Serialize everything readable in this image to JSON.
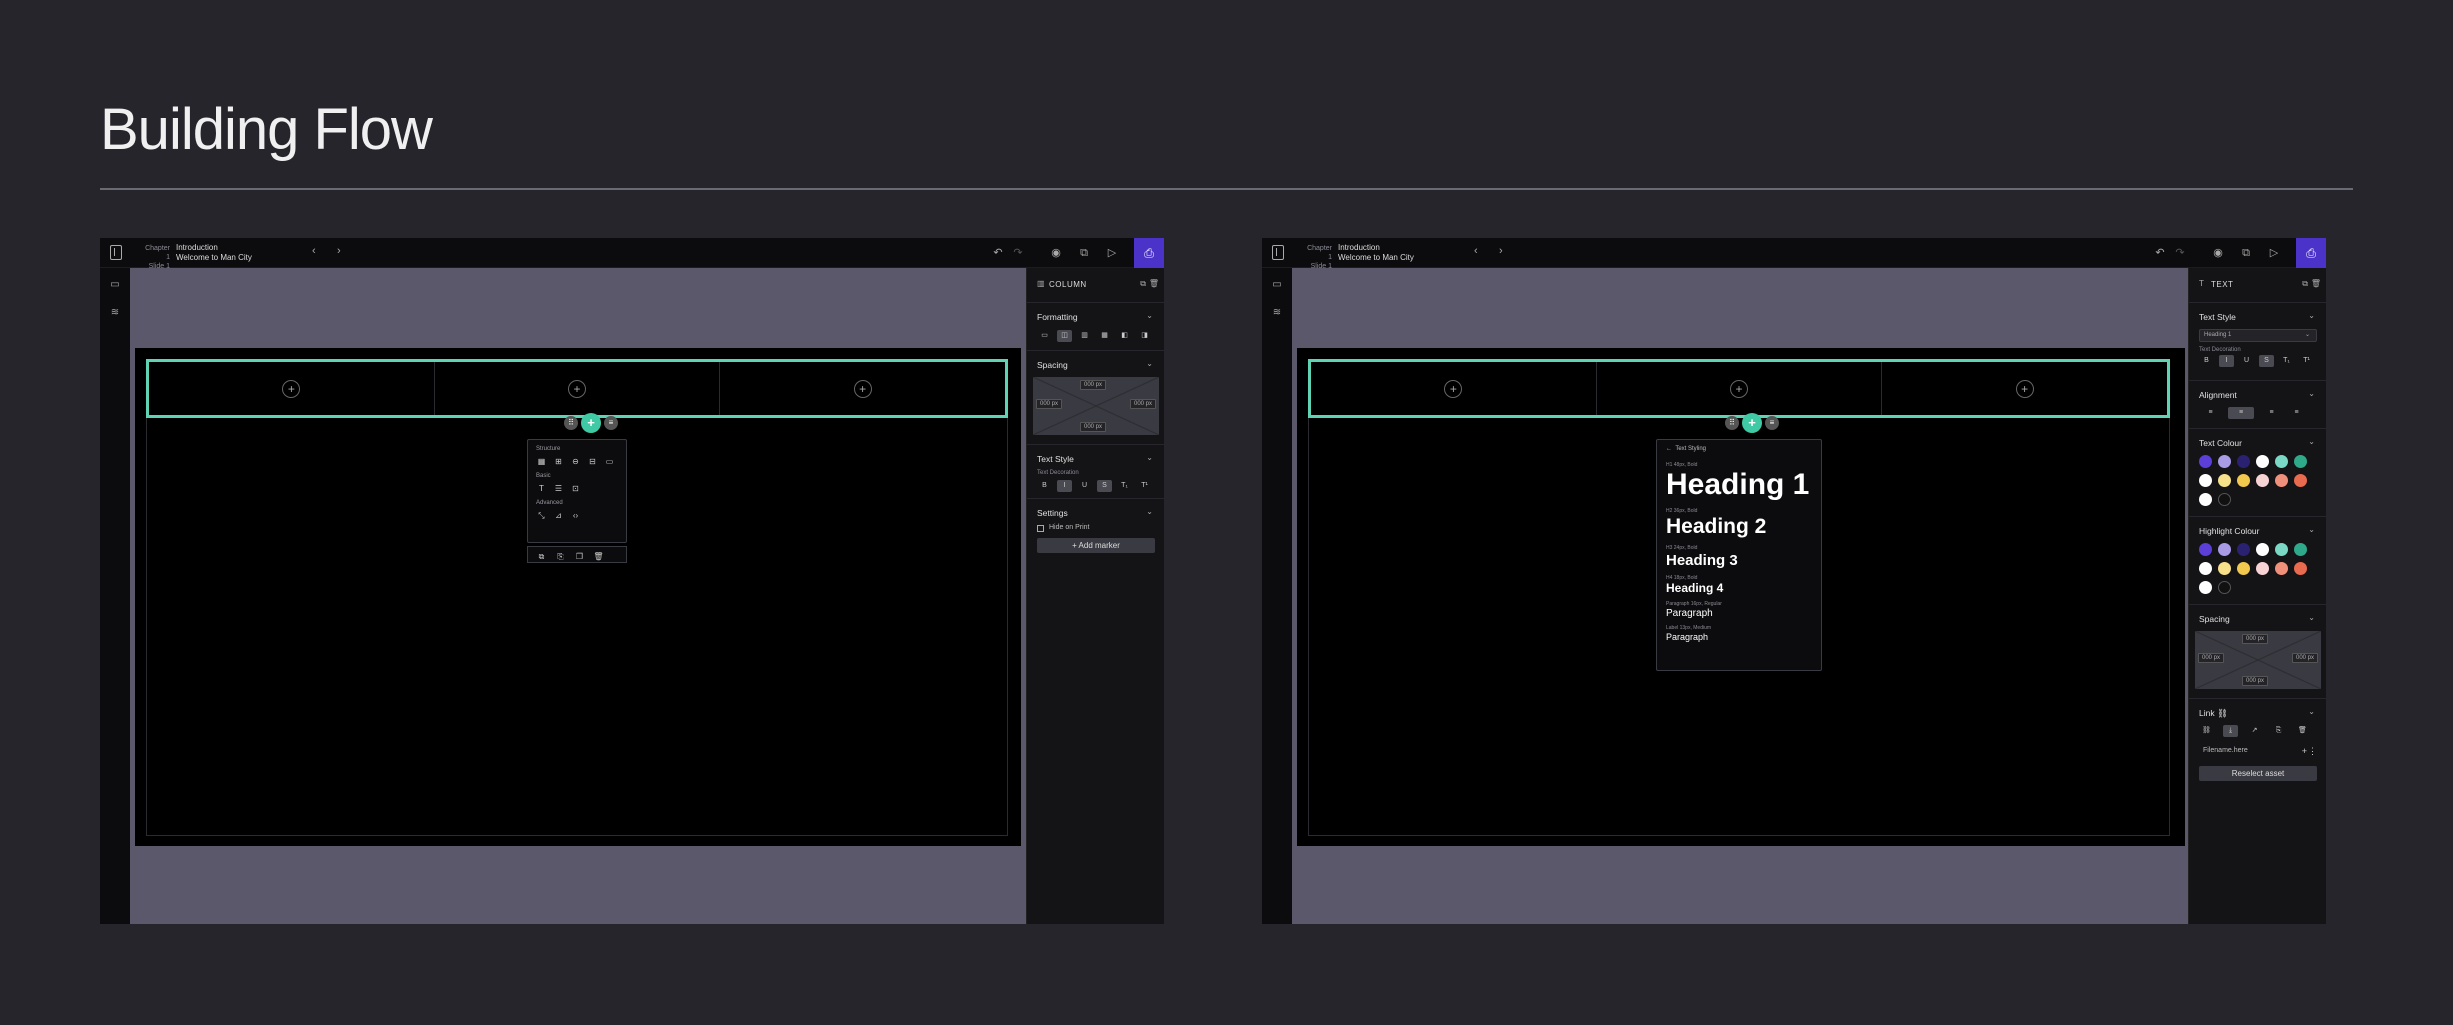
{
  "page": {
    "title": "Building Flow"
  },
  "topbar": {
    "chapter_label": "Chapter 1",
    "slide_label": "Slide 1",
    "chapter_name": "Introduction",
    "slide_name": "Welcome to Man City",
    "prev": "‹",
    "next": "›",
    "undo": "↶",
    "redo": "↷",
    "preview": "◉",
    "duplicate": "⧉",
    "play": "▷",
    "save": "⎙"
  },
  "canvas": {
    "add": "+"
  },
  "left_panel": {
    "title": "COLUMN",
    "formatting": "Formatting",
    "spacing": "Spacing",
    "spacing_value": "000 px",
    "text_style": "Text Style",
    "text_decoration": "Text Decoration",
    "decorations": [
      "B",
      "I",
      "U",
      "S",
      "T₁",
      "T¹"
    ],
    "settings": "Settings",
    "hide_on_print": "Hide on Print",
    "add_marker": "+ Add marker",
    "popover": {
      "structure": "Structure",
      "basic": "Basic",
      "advanced": "Advanced"
    }
  },
  "right_panel": {
    "title": "TEXT",
    "text_style": "Text Style",
    "style_select": "Heading 1",
    "text_decoration": "Text Decoration",
    "alignment": "Alignment",
    "text_colour": "Text Colour",
    "highlight_colour": "Highlight Colour",
    "spacing": "Spacing",
    "spacing_value": "000 px",
    "link": "Link",
    "link_value": "Filename.here",
    "reselect_asset": "Reselect asset"
  },
  "typography": {
    "header": "Text Styling",
    "items": [
      {
        "meta": "H1  48px, Bold",
        "label": "Heading 1"
      },
      {
        "meta": "H2  36px, Bold",
        "label": "Heading 2"
      },
      {
        "meta": "H3  24px, Bold",
        "label": "Heading 3"
      },
      {
        "meta": "H4  18px, Bold",
        "label": "Heading 4"
      },
      {
        "meta": "Paragraph  16px, Regular",
        "label": "Paragraph"
      },
      {
        "meta": "Label  13px, Medium",
        "label": "Paragraph"
      }
    ]
  },
  "colors": {
    "accent": "#3fc9a4",
    "brand": "#4b33c9",
    "text_swatches": [
      "#5b3fd6",
      "#a99be6",
      "#2a2270",
      "#ffffff",
      "#7ad8c4",
      "#2ea98a",
      "#ffffff",
      "#f7e08a",
      "#f2c94c",
      "#f8d3d3",
      "#f1907a",
      "#e86a4f",
      "#ffffff",
      "#111111"
    ]
  }
}
